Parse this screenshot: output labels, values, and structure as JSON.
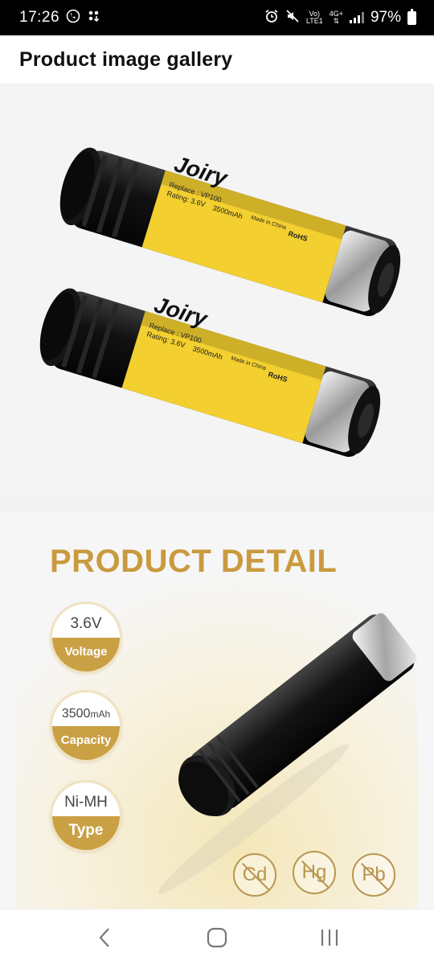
{
  "status_bar": {
    "time": "17:26",
    "network_label_top": "Vo)",
    "network_label_bottom": "LTE1",
    "network_type": "4G+",
    "battery_percent": "97%"
  },
  "header": {
    "title": "Product image gallery"
  },
  "gallery": {
    "image1": {
      "brand": "Joiry",
      "replace_text": "Replace : VP100",
      "rating_text": "Rating: 3.6V",
      "capacity_text": "3500mAh",
      "made_in": "Made in China",
      "rohs": "RoHS"
    },
    "image2": {
      "title": "PRODUCT DETAIL",
      "specs": [
        {
          "value": "3.6V",
          "label": "Voltage"
        },
        {
          "value": "3500",
          "unit": "mAh",
          "label": "Capacity"
        },
        {
          "value": "Ni-MH",
          "label": "Type"
        }
      ],
      "hazard_free": [
        "Cd",
        "Hg",
        "Pb"
      ]
    }
  },
  "colors": {
    "accent_gold": "#caa045",
    "label_yellow": "#f3cf2f"
  },
  "nav": {
    "back_icon": "chevron-left-icon",
    "home_icon": "home-icon",
    "recents_icon": "recents-icon"
  }
}
